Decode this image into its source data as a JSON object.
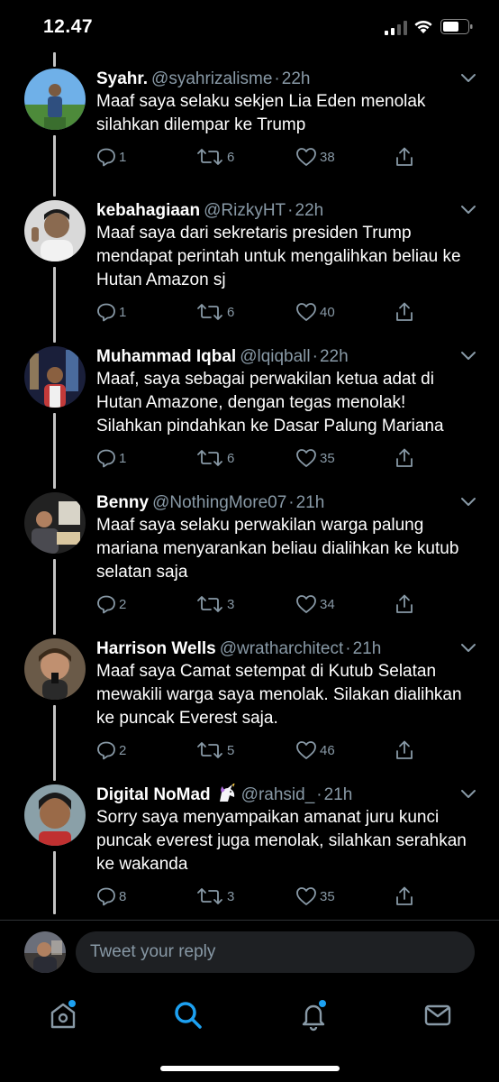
{
  "status_bar": {
    "time": "12.47"
  },
  "tweets": [
    {
      "name": "Syahr.",
      "handle": "@syahrizalisme",
      "time": "22h",
      "text": "Maaf saya selaku sekjen Lia Eden menolak silahkan dilempar ke Trump",
      "replies": "1",
      "retweets": "6",
      "likes": "38"
    },
    {
      "name": "kebahagiaan",
      "handle": "@RizkyHT",
      "time": "22h",
      "text": "Maaf saya dari sekretaris presiden Trump mendapat perintah untuk mengalihkan beliau ke Hutan Amazon sj",
      "replies": "1",
      "retweets": "6",
      "likes": "40"
    },
    {
      "name": "Muhammad Iqbal",
      "handle": "@lqiqball",
      "time": "22h",
      "text": "Maaf, saya sebagai perwakilan ketua adat di Hutan Amazone, dengan tegas menolak! Silahkan pindahkan ke Dasar Palung Mariana",
      "replies": "1",
      "retweets": "6",
      "likes": "35"
    },
    {
      "name": "Benny",
      "handle": "@NothingMore07",
      "time": "21h",
      "text": "Maaf saya selaku perwakilan warga palung mariana menyarankan beliau dialihkan ke kutub selatan saja",
      "replies": "2",
      "retweets": "3",
      "likes": "34"
    },
    {
      "name": "Harrison Wells",
      "handle": "@wratharchitect",
      "time": "21h",
      "text": "Maaf saya Camat setempat di Kutub Selatan mewakili warga saya menolak. Silakan dialihkan ke puncak Everest saja.",
      "replies": "2",
      "retweets": "5",
      "likes": "46"
    },
    {
      "name": "Digital NoMad",
      "handle": "@rahsid_",
      "time": "21h",
      "text": "Sorry saya menyampaikan amanat juru kunci puncak everest juga menolak, silahkan serahkan ke wakanda",
      "replies": "8",
      "retweets": "3",
      "likes": "35"
    }
  ],
  "separator": "·",
  "reply": {
    "placeholder": "Tweet your reply"
  },
  "colors": {
    "background": "#000000",
    "muted": "#8899a6",
    "accent": "#1da1f2",
    "thread_line": "#c4c4c4"
  },
  "tabs": [
    {
      "icon": "home-icon",
      "active": false,
      "badge": true
    },
    {
      "icon": "search-icon",
      "active": true,
      "badge": false
    },
    {
      "icon": "bell-icon",
      "active": false,
      "badge": true
    },
    {
      "icon": "mail-icon",
      "active": false,
      "badge": false
    }
  ]
}
